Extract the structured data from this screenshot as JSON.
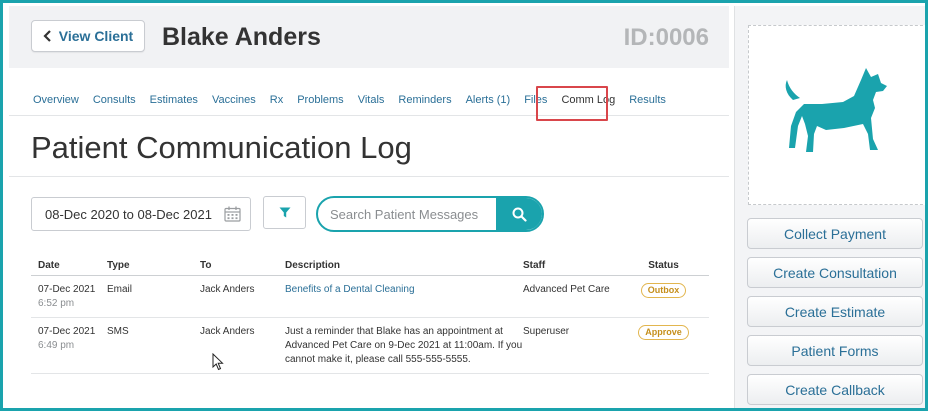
{
  "header": {
    "view_client_label": "View Client",
    "client_name": "Blake Anders",
    "client_id": "ID:0006"
  },
  "tabs": [
    {
      "label": "Overview"
    },
    {
      "label": "Consults"
    },
    {
      "label": "Estimates"
    },
    {
      "label": "Vaccines"
    },
    {
      "label": "Rx"
    },
    {
      "label": "Problems"
    },
    {
      "label": "Vitals"
    },
    {
      "label": "Reminders"
    },
    {
      "label": "Alerts (1)"
    },
    {
      "label": "Files"
    },
    {
      "label": "Comm Log",
      "active": true
    },
    {
      "label": "Results"
    }
  ],
  "page_title": "Patient Communication Log",
  "filters": {
    "date_range": "08-Dec 2020 to 08-Dec 2021",
    "search_placeholder": "Search Patient Messages"
  },
  "table": {
    "headers": {
      "date": "Date",
      "type": "Type",
      "to": "To",
      "description": "Description",
      "staff": "Staff",
      "status": "Status"
    },
    "rows": [
      {
        "date": "07-Dec 2021",
        "time": "6:52 pm",
        "type": "Email",
        "to": "Jack Anders",
        "description": "Benefits of a Dental Cleaning",
        "staff": "Advanced Pet Care",
        "status": "Outbox"
      },
      {
        "date": "07-Dec 2021",
        "time": "6:49 pm",
        "type": "SMS",
        "to": "Jack Anders",
        "description": "Just a reminder that Blake has an appointment at Advanced Pet Care on 9-Dec 2021 at 11:00am. If you cannot make it, please call 555-555-5555.",
        "staff": "Superuser",
        "status": "Approve"
      }
    ]
  },
  "actions": [
    {
      "label": "Collect Payment"
    },
    {
      "label": "Create Consultation"
    },
    {
      "label": "Create Estimate"
    },
    {
      "label": "Patient Forms"
    },
    {
      "label": "Create Callback"
    }
  ],
  "icons": {
    "back": "chevron-left-icon",
    "calendar": "calendar-icon",
    "filter": "filter-icon",
    "search": "search-icon",
    "patient": "dog-silhouette-icon",
    "pointer": "mouse-cursor-icon"
  },
  "colors": {
    "accent": "#1aa3ad",
    "link": "#2a6f97",
    "status_badge": "#e2b64f",
    "highlight": "#d9464b"
  }
}
